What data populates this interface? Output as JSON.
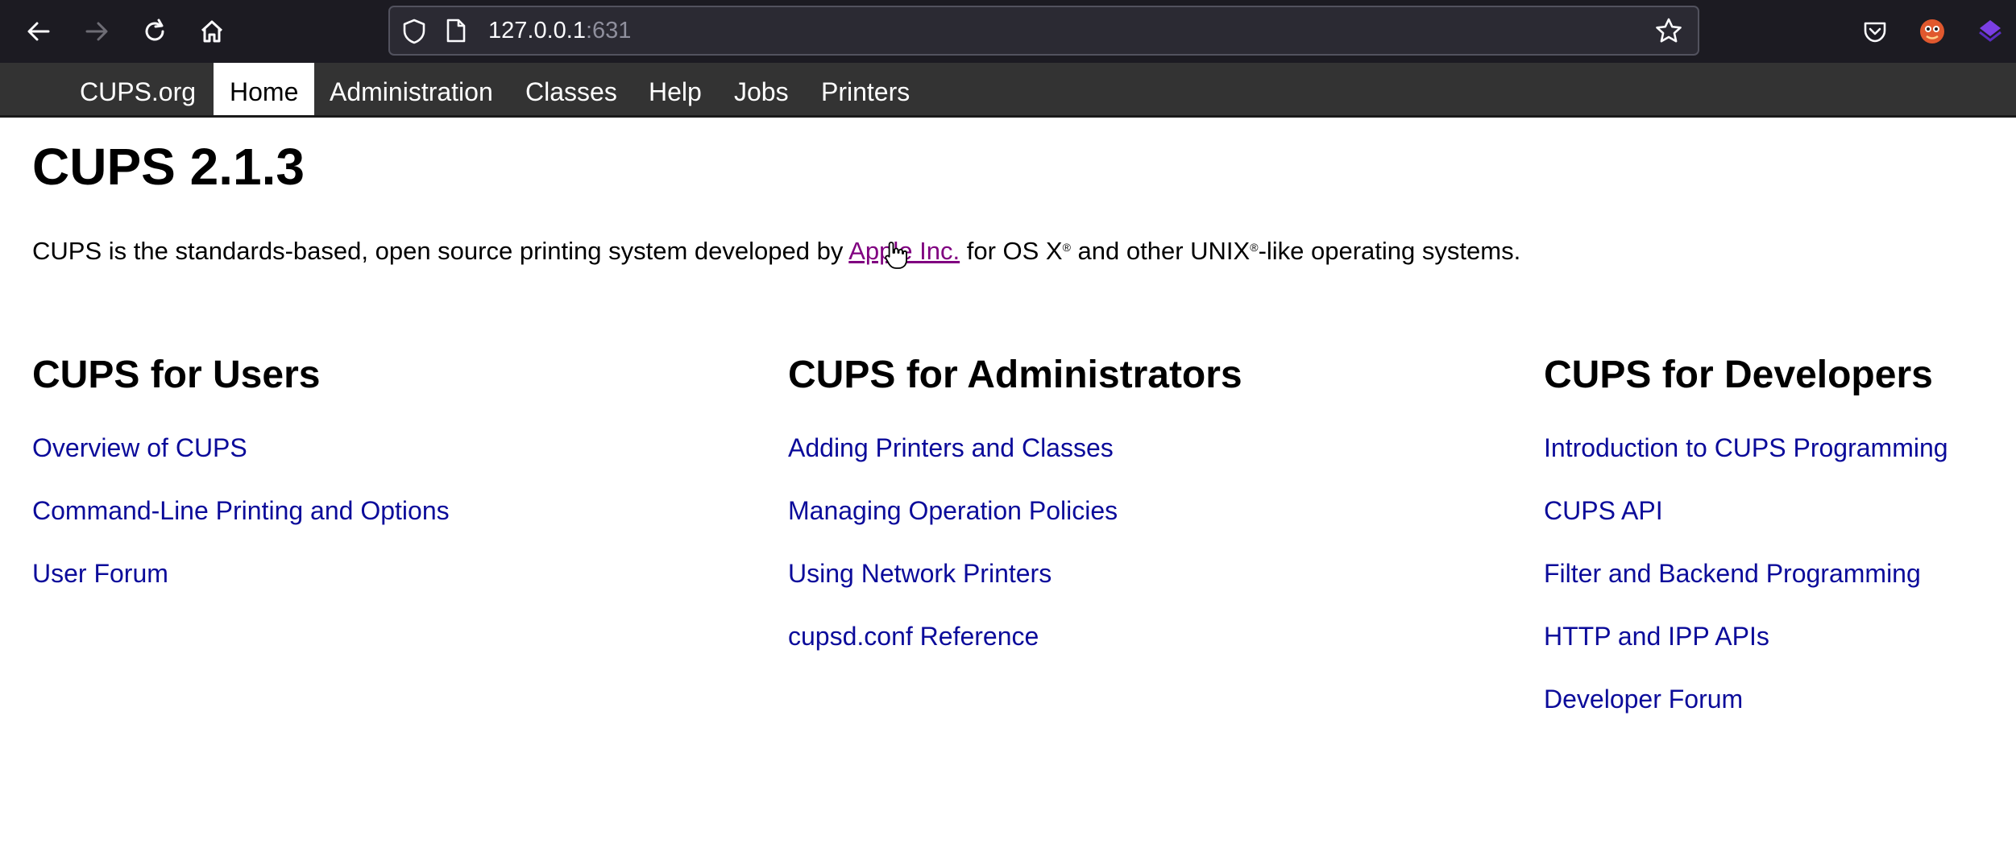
{
  "browser": {
    "url_host": "127.0.0.1",
    "url_port": ":631",
    "icons": [
      "back-icon",
      "forward-icon",
      "reload-icon",
      "home-icon",
      "shield-icon",
      "page-icon",
      "bookmark-star-icon",
      "pocket-icon",
      "extension-fox-icon",
      "extension-purple-icon"
    ]
  },
  "nav": {
    "items": [
      {
        "label": "CUPS.org",
        "active": false
      },
      {
        "label": "Home",
        "active": true
      },
      {
        "label": "Administration",
        "active": false
      },
      {
        "label": "Classes",
        "active": false
      },
      {
        "label": "Help",
        "active": false
      },
      {
        "label": "Jobs",
        "active": false
      },
      {
        "label": "Printers",
        "active": false
      }
    ]
  },
  "main": {
    "title": "CUPS 2.1.3",
    "intro_before": "CUPS is the standards-based, open source printing system developed by ",
    "intro_link": "Apple Inc.",
    "intro_mid": " for OS X",
    "reg1": "®",
    "intro_mid2": " and other UNIX",
    "reg2": "®",
    "intro_after": "-like operating systems."
  },
  "columns": [
    {
      "heading": "CUPS for Users",
      "links": [
        "Overview of CUPS",
        "Command-Line Printing and Options",
        "User Forum"
      ]
    },
    {
      "heading": "CUPS for Administrators",
      "links": [
        "Adding Printers and Classes",
        "Managing Operation Policies",
        "Using Network Printers",
        "cupsd.conf Reference"
      ]
    },
    {
      "heading": "CUPS for Developers",
      "links": [
        "Introduction to CUPS Programming",
        "CUPS API",
        "Filter and Backend Programming",
        "HTTP and IPP APIs",
        "Developer Forum"
      ]
    }
  ],
  "colors": {
    "link": "#0b0b9a",
    "visited_link": "#800080",
    "nav_bg": "#333333",
    "chrome_bg": "#1c1b22"
  }
}
